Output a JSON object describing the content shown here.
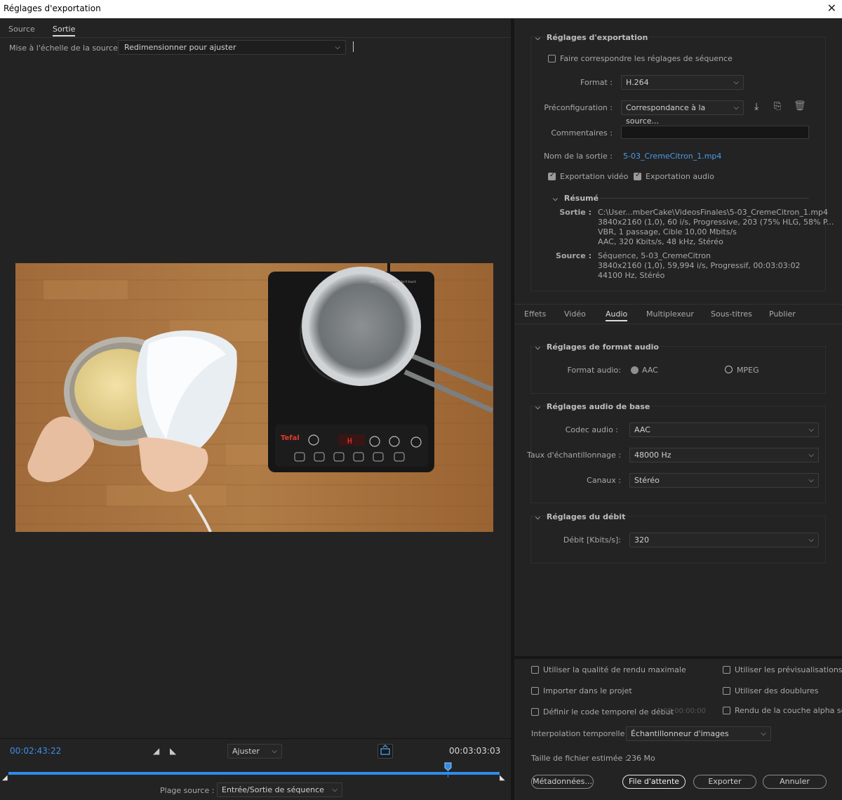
{
  "window": {
    "title": "Réglages d'exportation"
  },
  "left": {
    "tabs": [
      {
        "label": "Source"
      },
      {
        "label": "Sortie"
      }
    ],
    "scale": {
      "label": "Mise à l'échelle de la source :",
      "value": "Redimensionner pour ajuster"
    },
    "timeline": {
      "current_time": "00:02:43:22",
      "duration": "00:03:03:03",
      "zoom_value": "Ajuster",
      "playhead_fraction": 0.895,
      "range_label": "Plage source :",
      "range_value": "Entrée/Sortie de séquence"
    },
    "preview": {
      "hob_brand": "Tefal",
      "hob_display": "H",
      "hob_note": "after cooking, please don't touch"
    }
  },
  "export_settings": {
    "section_title": "Réglages d'exportation",
    "match_sequence": "Faire correspondre les réglages de séquence",
    "format_label": "Format :",
    "format_value": "H.264",
    "preset_label": "Préconfiguration :",
    "preset_value": "Correspondance à la source...",
    "comments_label": "Commentaires :",
    "comments_value": "",
    "output_name_label": "Nom de la sortie :",
    "output_name": "5-03_CremeCitron_1.mp4",
    "export_video": "Exportation vidéo",
    "export_audio": "Exportation audio",
    "summary": {
      "title": "Résumé",
      "output_label": "Sortie :",
      "output_lines": [
        "C:\\User...mberCake\\VideosFinales\\5-03_CremeCitron_1.mp4",
        "3840x2160 (1,0), 60 i/s, Progressive, 203 (75% HLG, 58% P...",
        "VBR, 1 passage, Cible 10,00  Mbits/s",
        "AAC, 320  Kbits/s, 48  kHz, Stéréo"
      ],
      "source_label": "Source :",
      "source_lines": [
        "Séquence, 5-03_CremeCitron",
        "3840x2160 (1,0), 59,994  i/s, Progressif, 00:03:03:02",
        "44100 Hz, Stéréo"
      ]
    }
  },
  "settings_tabs": [
    {
      "label": "Effets"
    },
    {
      "label": "Vidéo"
    },
    {
      "label": "Audio"
    },
    {
      "label": "Multiplexeur"
    },
    {
      "label": "Sous-titres"
    },
    {
      "label": "Publier"
    }
  ],
  "audio": {
    "format_section": "Réglages de format audio",
    "format_label": "Format audio:",
    "option_aac": "AAC",
    "option_mpeg": "MPEG",
    "basic_section": "Réglages audio de base",
    "codec_label": "Codec audio :",
    "codec_value": "AAC",
    "rate_label": "Taux d'échantillonnage :",
    "rate_value": "48000  Hz",
    "channels_label": "Canaux :",
    "channels_value": "Stéréo",
    "bitrate_section": "Réglages du débit",
    "bitrate_label": "Débit [Kbits/s]:",
    "bitrate_value": "320"
  },
  "bottom": {
    "max_quality": "Utiliser la qualité de rendu maximale",
    "use_previews": "Utiliser les prévisualisations",
    "import_project": "Importer dans le projet",
    "use_proxies": "Utiliser des doublures",
    "set_timecode": "Définir le code temporel de début",
    "timecode_value": "00:00:00:00",
    "alpha_render": "Rendu de la couche alpha seule",
    "interp_label": "Interpolation temporelle :",
    "interp_value": "Échantillonneur d'images",
    "filesize_label": "Taille de fichier estimée :",
    "filesize_value": "236 Mo",
    "buttons": {
      "metadata": "Métadonnées...",
      "queue": "File d'attente",
      "export": "Exporter",
      "cancel": "Annuler"
    }
  },
  "colors": {
    "accent": "#2d8ceb",
    "link": "#4a9be8",
    "panel": "#232323",
    "field": "#1b1b1b"
  }
}
